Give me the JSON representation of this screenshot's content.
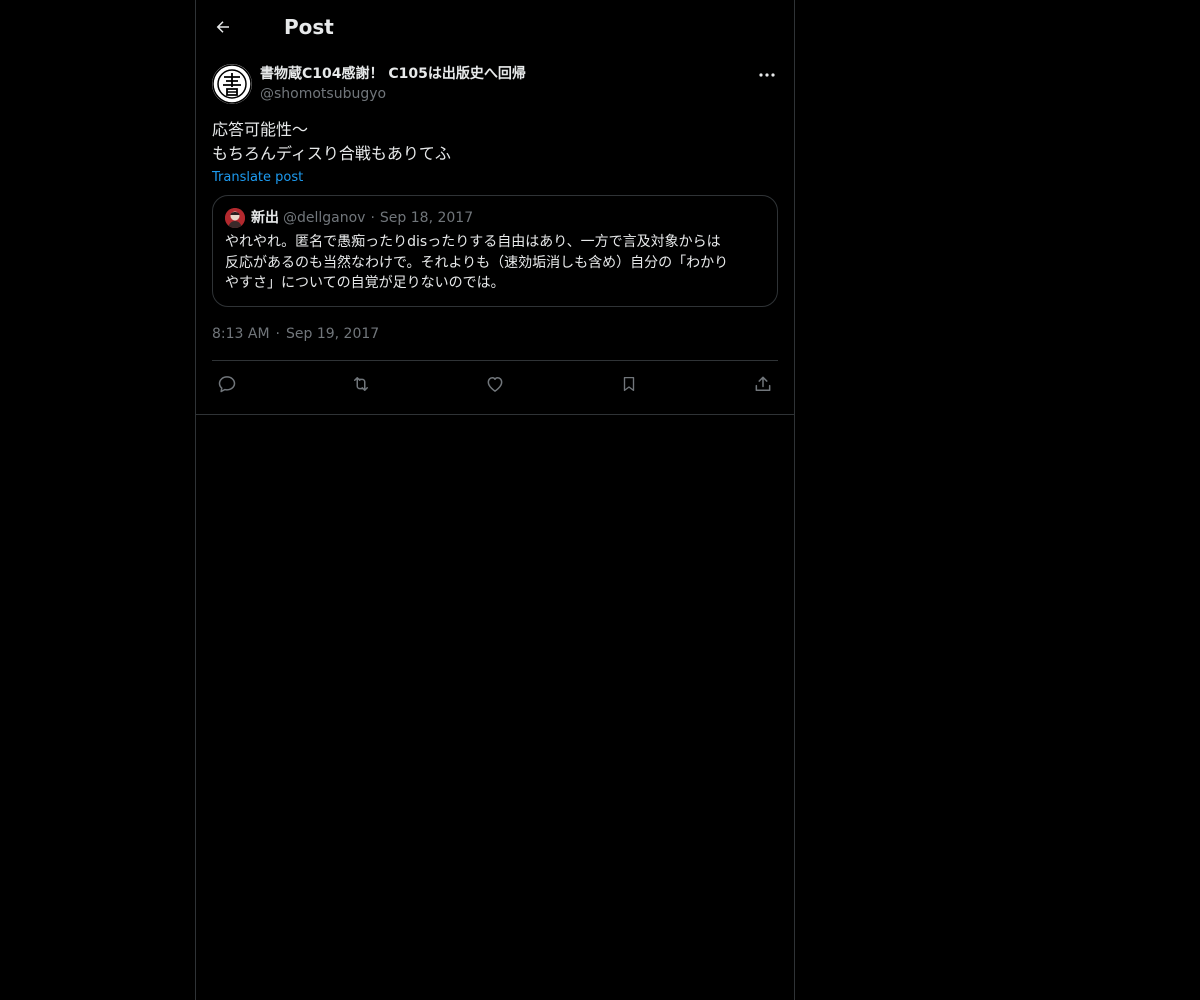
{
  "header": {
    "title": "Post"
  },
  "post": {
    "author": {
      "display_name": "書物蔵C104感謝！ C105は出版史へ回帰",
      "handle": "@shomotsubugyo",
      "avatar_icon": "book-kanji-avatar"
    },
    "text": "応答可能性〜\nもちろんディスり合戦もありてふ",
    "translate_label": "Translate post",
    "quote": {
      "display_name": "新出",
      "handle": "@dellganov",
      "separator": "·",
      "date": "Sep 18, 2017",
      "text": "やれやれ。匿名で愚痴ったりdisったりする自由はあり、一方で言及対象からは\n反応があるのも当然なわけで。それよりも（速効垢消しも含め）自分の「わかり\nやすさ」についての自覚が足りないのでは。"
    },
    "time": "8:13 AM",
    "separator": "·",
    "date": "Sep 19, 2017"
  },
  "actions": [
    {
      "name": "reply",
      "icon": "reply-icon"
    },
    {
      "name": "repost",
      "icon": "repost-icon"
    },
    {
      "name": "like",
      "icon": "heart-icon"
    },
    {
      "name": "bookmark",
      "icon": "bookmark-icon"
    },
    {
      "name": "share",
      "icon": "share-icon"
    }
  ],
  "colors": {
    "background": "#000000",
    "text": "#e7e9ea",
    "muted": "#71767b",
    "link": "#1d9bf0",
    "border": "#2f3336"
  }
}
